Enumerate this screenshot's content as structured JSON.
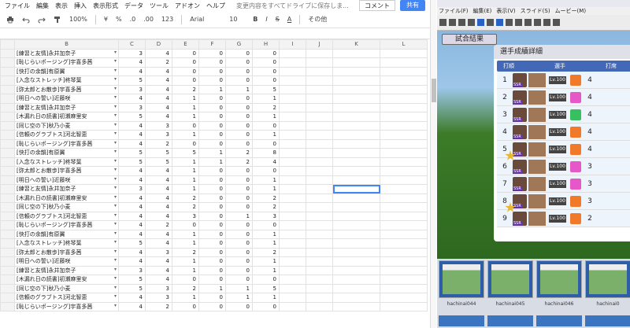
{
  "sheet": {
    "menu": [
      "ファイル",
      "編集",
      "表示",
      "挿入",
      "表示形式",
      "データ",
      "ツール",
      "アドオン",
      "ヘルプ"
    ],
    "changed_notice": "変更内容をすべてドライブに保存しま...",
    "comment_label": "コメント",
    "share_label": "共有",
    "toolbar": {
      "zoom": "100%",
      "currency": "¥",
      "percent": "%",
      "decimal_down": ".0",
      "decimal_up": ".00",
      "format_more": "123",
      "font": "Arial",
      "font_size": "10",
      "bold": "B",
      "italic": "I",
      "strike": "S",
      "text_color": "A",
      "more": "その他"
    },
    "columns": [
      "",
      "A",
      "B",
      "C",
      "D",
      "E",
      "F",
      "G",
      "H",
      "I",
      "J",
      "K",
      "L"
    ],
    "rows": [
      [
        "[練習と友情]永井加奈子",
        "3",
        "4",
        "0",
        "0",
        "0",
        "0"
      ],
      [
        "[恥じらいポージング]宇喜多茜",
        "4",
        "2",
        "0",
        "0",
        "0",
        "0"
      ],
      [
        "[快打の余韻]有原翼",
        "4",
        "4",
        "0",
        "0",
        "0",
        "0"
      ],
      [
        "[入念なストレッチ]柊琴葉",
        "5",
        "4",
        "0",
        "0",
        "0",
        "0"
      ],
      [
        "[弥太郎とお散歩]宇喜多茜",
        "3",
        "4",
        "2",
        "1",
        "1",
        "5"
      ],
      [
        "[明日への誓い]近藤咲",
        "4",
        "4",
        "1",
        "0",
        "0",
        "1"
      ],
      [
        "[練習と友情]永井加奈子",
        "3",
        "4",
        "1",
        "0",
        "0",
        "2"
      ],
      [
        "[木漏れ日の読書]初瀬麻里安",
        "5",
        "4",
        "1",
        "0",
        "0",
        "1"
      ],
      [
        "[同じ空の下]秋乃小麦",
        "4",
        "3",
        "0",
        "0",
        "0",
        "0"
      ],
      [
        "[信頼のグラブトス]河北智恵",
        "4",
        "3",
        "1",
        "0",
        "0",
        "1"
      ],
      [
        "[恥じらいポージング]宇喜多茜",
        "4",
        "2",
        "0",
        "0",
        "0",
        "0"
      ],
      [
        "[快打の余韻]有原翼",
        "5",
        "5",
        "5",
        "1",
        "2",
        "8"
      ],
      [
        "[入念なストレッチ]柊琴葉",
        "5",
        "5",
        "1",
        "1",
        "2",
        "4"
      ],
      [
        "[弥太郎とお散歩]宇喜多茜",
        "4",
        "4",
        "1",
        "0",
        "0",
        "0"
      ],
      [
        "[明日への誓い]近藤咲",
        "4",
        "4",
        "1",
        "0",
        "0",
        "1"
      ],
      [
        "[練習と友情]永井加奈子",
        "3",
        "4",
        "1",
        "0",
        "0",
        "1"
      ],
      [
        "[木漏れ日の読書]初瀬麻里安",
        "4",
        "4",
        "2",
        "0",
        "0",
        "2"
      ],
      [
        "[同じ空の下]秋乃小麦",
        "4",
        "4",
        "2",
        "0",
        "0",
        "2"
      ],
      [
        "[信頼のグラブトス]河北智恵",
        "4",
        "4",
        "3",
        "0",
        "1",
        "3"
      ],
      [
        "[恥じらいポージング]宇喜多茜",
        "4",
        "2",
        "0",
        "0",
        "0",
        "0"
      ],
      [
        "[快打の余韻]有原翼",
        "4",
        "4",
        "1",
        "0",
        "0",
        "1"
      ],
      [
        "[入念なストレッチ]柊琴葉",
        "5",
        "4",
        "1",
        "0",
        "0",
        "1"
      ],
      [
        "[弥太郎とお散歩]宇喜多茜",
        "4",
        "3",
        "2",
        "0",
        "0",
        "2"
      ],
      [
        "[明日への誓い]近藤咲",
        "4",
        "4",
        "1",
        "0",
        "0",
        "1"
      ],
      [
        "[練習と友情]永井加奈子",
        "3",
        "4",
        "1",
        "0",
        "0",
        "1"
      ],
      [
        "[木漏れ日の読書]初瀬麻里安",
        "5",
        "4",
        "0",
        "0",
        "0",
        "0"
      ],
      [
        "[同じ空の下]秋乃小麦",
        "5",
        "3",
        "2",
        "1",
        "1",
        "5"
      ],
      [
        "[信頼のグラブトス]河北智恵",
        "4",
        "3",
        "1",
        "0",
        "1",
        "1"
      ],
      [
        "[恥じらいポージング]宇喜多茜",
        "4",
        "2",
        "0",
        "0",
        "0",
        "0"
      ]
    ]
  },
  "viewer": {
    "menu": [
      "ファイル(F)",
      "編集(E)",
      "表示(V)",
      "スライド(S)",
      "ムービー(M)"
    ],
    "result_label": "試合結果",
    "panel_title": "選手成績詳細",
    "header": [
      "打順",
      "選手",
      "打席"
    ],
    "lv_label": "Lv.100",
    "ssr_label": "SSR",
    "players": [
      {
        "order": "1",
        "bat": "4",
        "face": "#f07a2a"
      },
      {
        "order": "2",
        "bat": "4",
        "face": "#e658c8"
      },
      {
        "order": "3",
        "bat": "4",
        "face": "#38c060"
      },
      {
        "order": "4",
        "bat": "4",
        "face": "#f07a2a"
      },
      {
        "order": "5",
        "bat": "4",
        "face": "#f07a2a"
      },
      {
        "order": "6",
        "bat": "3",
        "face": "#e658c8"
      },
      {
        "order": "7",
        "bat": "3",
        "face": "#e658c8"
      },
      {
        "order": "8",
        "bat": "3",
        "face": "#f07a2a"
      },
      {
        "order": "9",
        "bat": "2",
        "face": "#f07a2a"
      }
    ],
    "thumbnails": [
      "hachinai044",
      "hachinai045",
      "hachinai046",
      "hachinai0"
    ]
  }
}
